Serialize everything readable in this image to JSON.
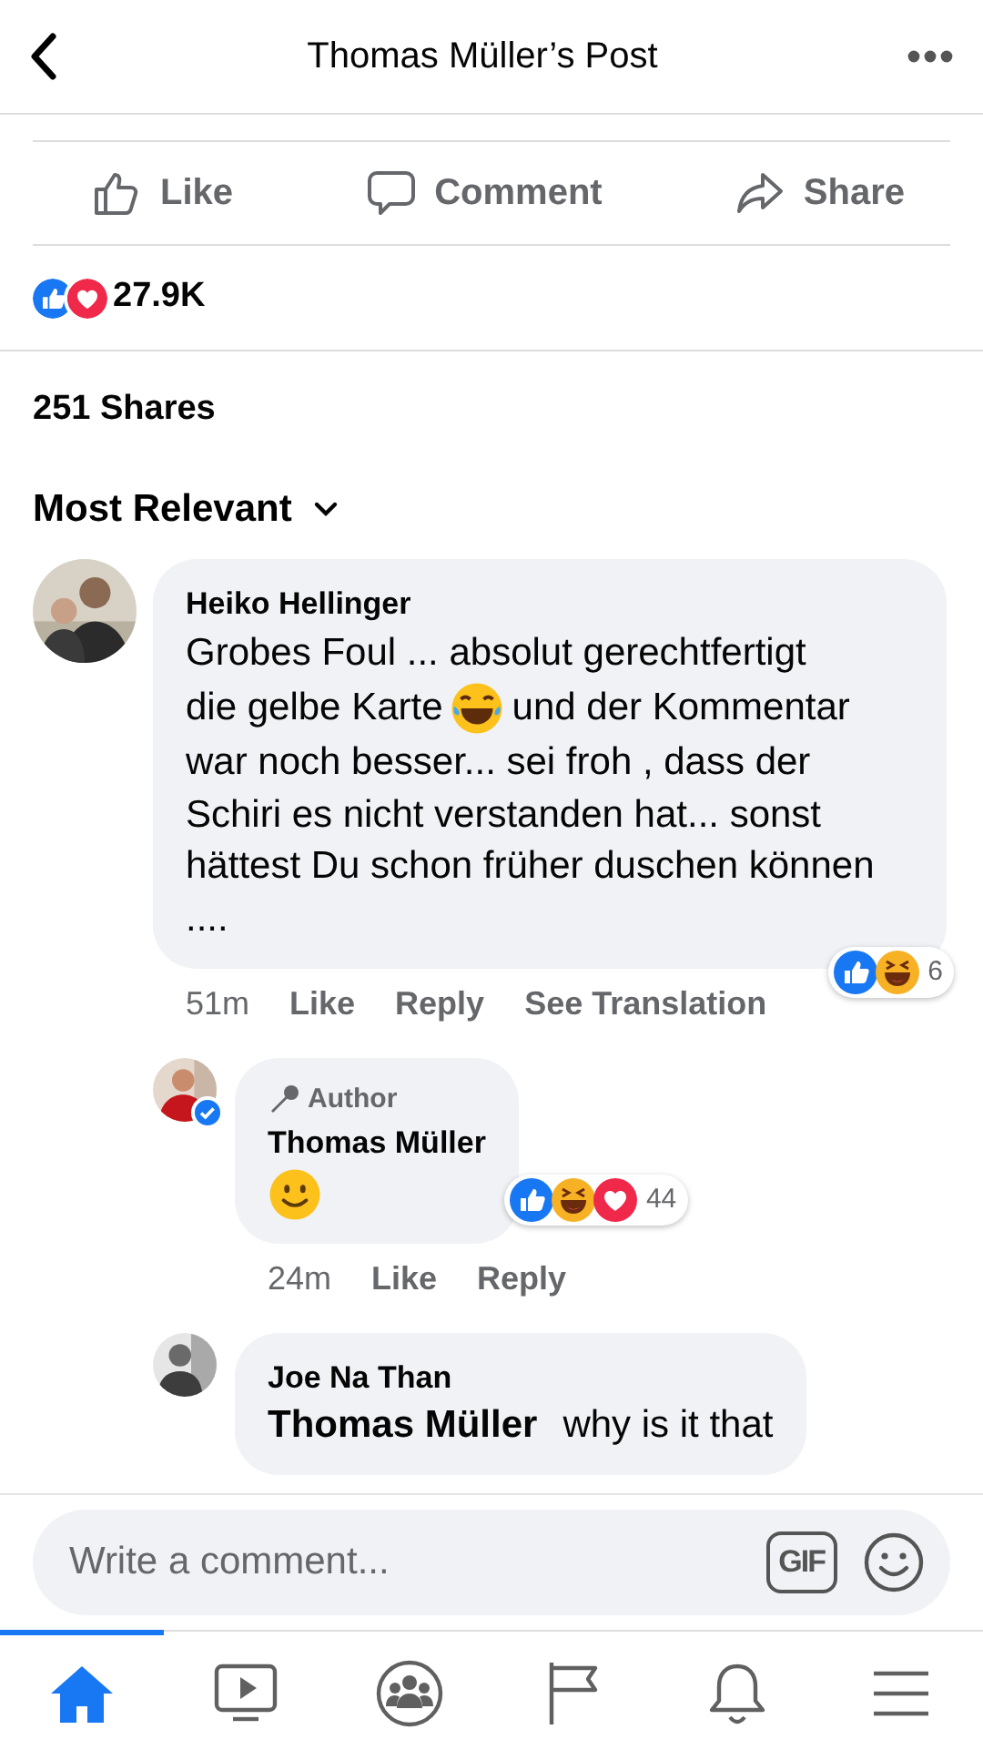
{
  "header": {
    "title": "Thomas Müller’s Post"
  },
  "actions": [
    {
      "kind": "like",
      "label": "Like"
    },
    {
      "kind": "comment",
      "label": "Comment"
    },
    {
      "kind": "share",
      "label": "Share"
    }
  ],
  "reactions_summary": {
    "reactions": [
      {
        "kind": "like"
      },
      {
        "kind": "love"
      }
    ],
    "count": "27.9K"
  },
  "shares": "251 Shares",
  "sort": {
    "label": "Most Relevant"
  },
  "comments": [
    {
      "author": "Heiko Hellinger",
      "verified": false,
      "reply": false,
      "body": [
        {
          "kind": "text",
          "text": "Grobes Foul ... absolut gerechtfertigt"
        },
        {
          "kind": "text",
          "text": "die gelbe Karte"
        },
        {
          "kind": "laugh_emoji"
        },
        {
          "kind": "text",
          "text": "und der Kommentar"
        },
        {
          "kind": "text",
          "text": "war noch besser... sei froh , dass der Schiri es nicht verstanden hat... sonst hättest Du schon früher duschen können ...."
        }
      ],
      "time": "51m",
      "links": [
        "Like",
        "Reply",
        "See Translation"
      ],
      "reactions": [
        {
          "kind": "like"
        },
        {
          "kind": "haha"
        }
      ],
      "reaction_count": "6"
    },
    {
      "author": "Thomas Müller",
      "author_badge": "Author",
      "verified": true,
      "reply": true,
      "body": [
        {
          "kind": "smile_emoji"
        }
      ],
      "time": "24m",
      "links": [
        "Like",
        "Reply"
      ],
      "reactions": [
        {
          "kind": "like"
        },
        {
          "kind": "haha"
        },
        {
          "kind": "love"
        }
      ],
      "reaction_count": "44"
    },
    {
      "author": "Joe Na Than",
      "verified": false,
      "reply": true,
      "body": [
        {
          "kind": "mention",
          "text": "Thomas Müller"
        },
        {
          "kind": "text",
          "text": "why is it that"
        }
      ]
    }
  ],
  "composer": {
    "placeholder": "Write a comment...",
    "gif_label": "GIF"
  },
  "tabs": [
    {
      "kind": "home",
      "selected": true
    },
    {
      "kind": "video",
      "selected": false
    },
    {
      "kind": "groups",
      "selected": false
    },
    {
      "kind": "pages",
      "selected": false
    },
    {
      "kind": "notifications",
      "selected": false
    },
    {
      "kind": "menu",
      "selected": false
    }
  ]
}
